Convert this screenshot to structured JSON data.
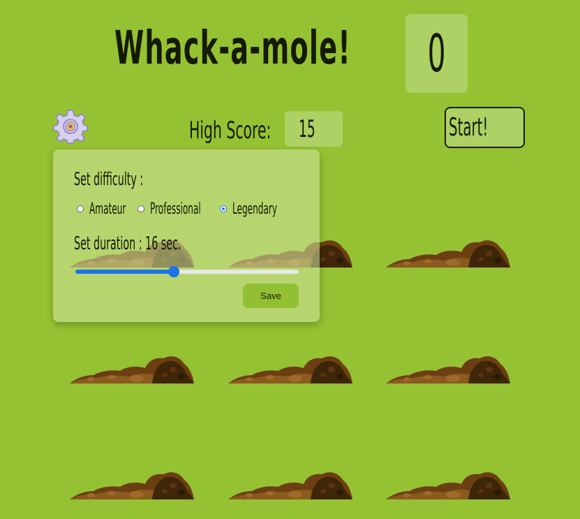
{
  "game": {
    "title": "Whack-a-mole!",
    "score": "0",
    "high_score_label": "High Score:",
    "high_score": "15",
    "start_label": "Start!"
  },
  "settings": {
    "difficulty_label": "Set difficulty :",
    "difficulty_options": [
      {
        "label": "Amateur",
        "checked": false
      },
      {
        "label": "Professional",
        "checked": false
      },
      {
        "label": "Legendary",
        "checked": true
      }
    ],
    "duration_label": "Set duration : 16 sec.",
    "duration_value": 16,
    "duration_fraction": 0.44,
    "save_label": "Save"
  },
  "icons": {
    "settings": "gear-icon",
    "hole": "dirt-mound-icon"
  },
  "colors": {
    "background": "#95c232",
    "box": "#add164",
    "text": "#151a05",
    "accent": "#1a73e8"
  }
}
